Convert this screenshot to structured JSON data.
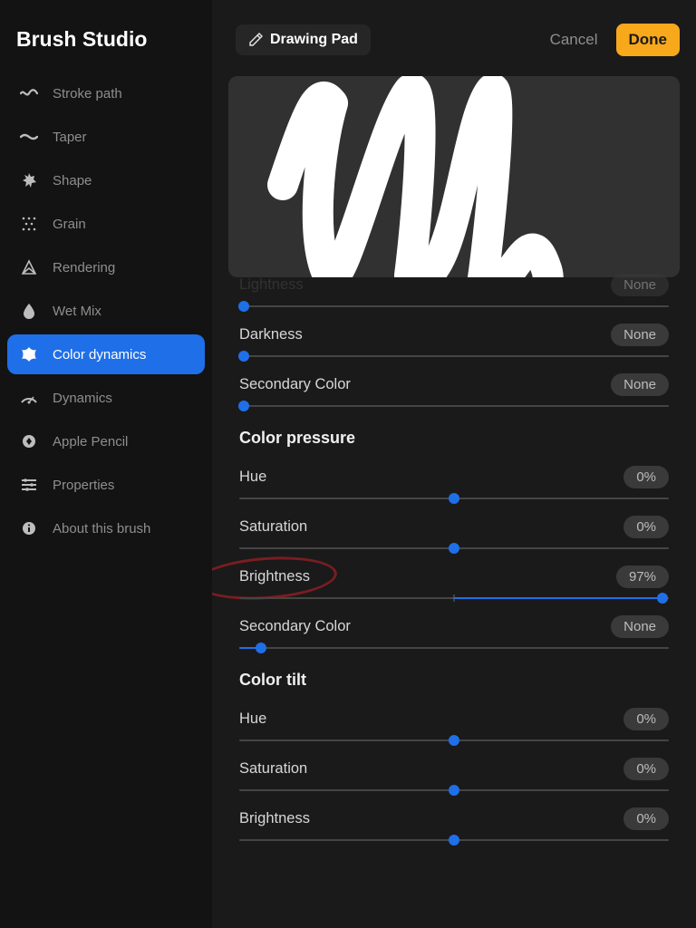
{
  "app_title": "Brush Studio",
  "sidebar": {
    "items": [
      {
        "label": "Stroke path",
        "icon": "stroke-path-icon"
      },
      {
        "label": "Taper",
        "icon": "taper-icon"
      },
      {
        "label": "Shape",
        "icon": "shape-icon"
      },
      {
        "label": "Grain",
        "icon": "grain-icon"
      },
      {
        "label": "Rendering",
        "icon": "rendering-icon"
      },
      {
        "label": "Wet Mix",
        "icon": "wet-mix-icon"
      },
      {
        "label": "Color dynamics",
        "icon": "color-dynamics-icon",
        "active": true
      },
      {
        "label": "Dynamics",
        "icon": "dynamics-icon"
      },
      {
        "label": "Apple Pencil",
        "icon": "apple-pencil-icon"
      },
      {
        "label": "Properties",
        "icon": "properties-icon"
      },
      {
        "label": "About this brush",
        "icon": "about-icon"
      }
    ]
  },
  "topbar": {
    "drawing_pad": "Drawing Pad",
    "cancel": "Cancel",
    "done": "Done"
  },
  "settings": {
    "partial_top": {
      "label": "Lightness",
      "value": "None",
      "thumb_pct": 1,
      "fill_from": 0,
      "fill_to": 1
    },
    "jitter_darkness": {
      "label": "Darkness",
      "value": "None",
      "thumb_pct": 1,
      "fill_from": 0,
      "fill_to": 1
    },
    "jitter_secondary": {
      "label": "Secondary Color",
      "value": "None",
      "thumb_pct": 1,
      "fill_from": 0,
      "fill_to": 1
    },
    "section_pressure": "Color pressure",
    "pressure_hue": {
      "label": "Hue",
      "value": "0%",
      "thumb_pct": 50,
      "center": true
    },
    "pressure_saturation": {
      "label": "Saturation",
      "value": "0%",
      "thumb_pct": 50,
      "center": true
    },
    "pressure_brightness": {
      "label": "Brightness",
      "value": "97%",
      "thumb_pct": 98.5,
      "center": true,
      "fill_from": 50,
      "fill_to": 98.5,
      "annotated": true
    },
    "pressure_secondary": {
      "label": "Secondary Color",
      "value": "None",
      "thumb_pct": 5,
      "fill_from": 0,
      "fill_to": 5
    },
    "section_tilt": "Color tilt",
    "tilt_hue": {
      "label": "Hue",
      "value": "0%",
      "thumb_pct": 50,
      "center": true
    },
    "tilt_saturation": {
      "label": "Saturation",
      "value": "0%",
      "thumb_pct": 50,
      "center": true
    },
    "tilt_brightness": {
      "label": "Brightness",
      "value": "0%",
      "thumb_pct": 50,
      "center": true
    }
  }
}
